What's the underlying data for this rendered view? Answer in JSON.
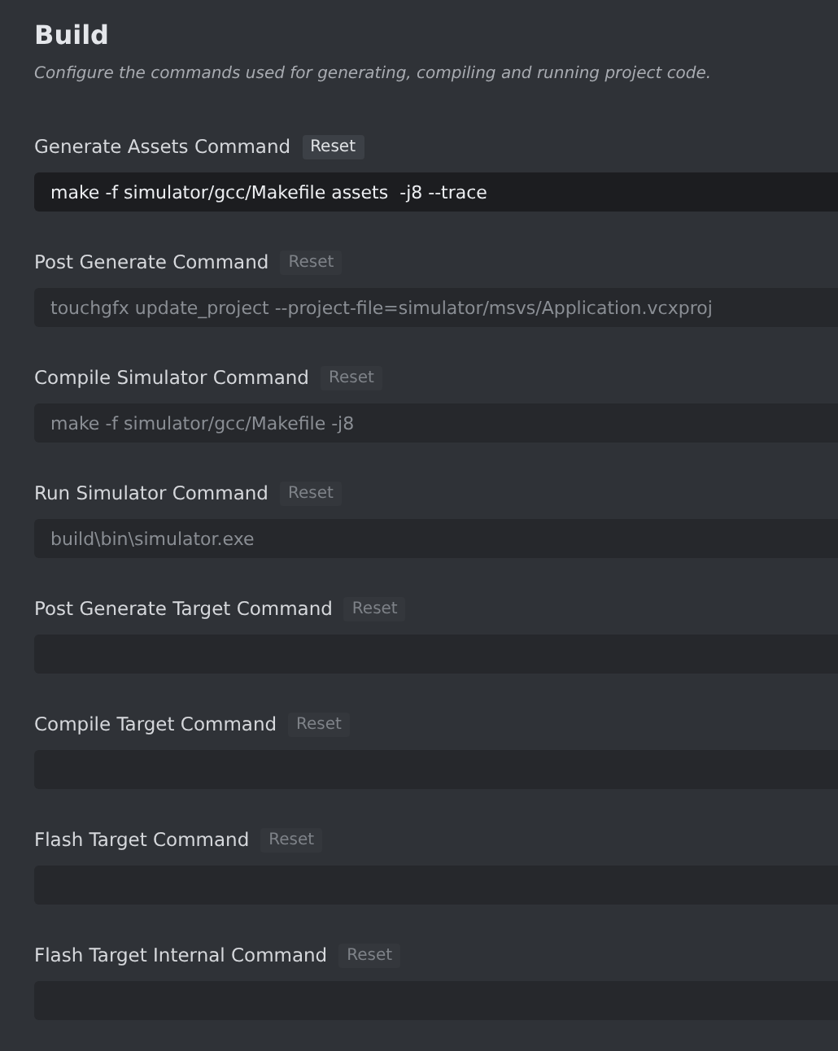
{
  "title": "Build",
  "description": "Configure the commands used for generating, compiling and running project code.",
  "commands": [
    {
      "label": "Generate Assets Command",
      "reset": "Reset",
      "modified": true,
      "value": "make -f simulator/gcc/Makefile assets  -j8 --trace"
    },
    {
      "label": "Post Generate Command",
      "reset": "Reset",
      "modified": false,
      "placeholder": "touchgfx update_project --project-file=simulator/msvs/Application.vcxproj"
    },
    {
      "label": "Compile Simulator Command",
      "reset": "Reset",
      "modified": false,
      "placeholder": "make -f simulator/gcc/Makefile -j8"
    },
    {
      "label": "Run Simulator Command",
      "reset": "Reset",
      "modified": false,
      "placeholder": "build\\bin\\simulator.exe"
    },
    {
      "label": "Post Generate Target Command",
      "reset": "Reset",
      "modified": false
    },
    {
      "label": "Compile Target Command",
      "reset": "Reset",
      "modified": false
    },
    {
      "label": "Flash Target Command",
      "reset": "Reset",
      "modified": false
    },
    {
      "label": "Flash Target Internal Command",
      "reset": "Reset",
      "modified": false
    }
  ]
}
